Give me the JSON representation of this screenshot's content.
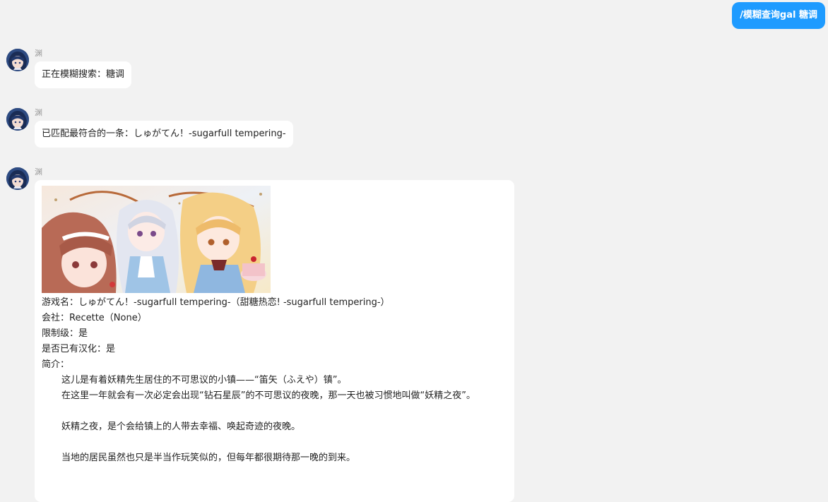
{
  "user_message": "/模糊查询gal 糖调",
  "bot_name": "渊",
  "messages": [
    {
      "text": "正在模糊搜索：糖调"
    },
    {
      "text": "已匹配最符合的一条：しゅがてん！-sugarfull tempering-"
    }
  ],
  "result": {
    "game_name_label": "游戏名：",
    "game_name": "しゅがてん！-sugarfull tempering-（甜糖热恋! -sugarfull tempering-）",
    "company_label": "会社：",
    "company": "Recette（None）",
    "rating_label": "限制级：",
    "rating": "是",
    "localized_label": "是否已有汉化：",
    "localized": "是",
    "intro_label": "简介：",
    "intro_lines": [
      "这儿是有着妖精先生居住的不可思议的小镇——“笛矢（ふえや）镇”。",
      "在这里一年就会有一次必定会出现“钻石星辰”的不可思议的夜晚，那一天也被习惯地叫做“妖精之夜”。",
      "",
      "妖精之夜，是个会给镇上的人带去幸福、唤起奇迹的夜晚。",
      "",
      "当地的居民虽然也只是半当作玩笑似的，但每年都很期待那一晚的到来。"
    ]
  },
  "colors": {
    "background": "#f2f2f2",
    "user_bubble": "#1e9bff",
    "bot_bubble": "#ffffff",
    "sender_text": "#9a9a9a"
  },
  "icons": {
    "avatar": "anime-avatar",
    "banner": "game-banner-image"
  }
}
